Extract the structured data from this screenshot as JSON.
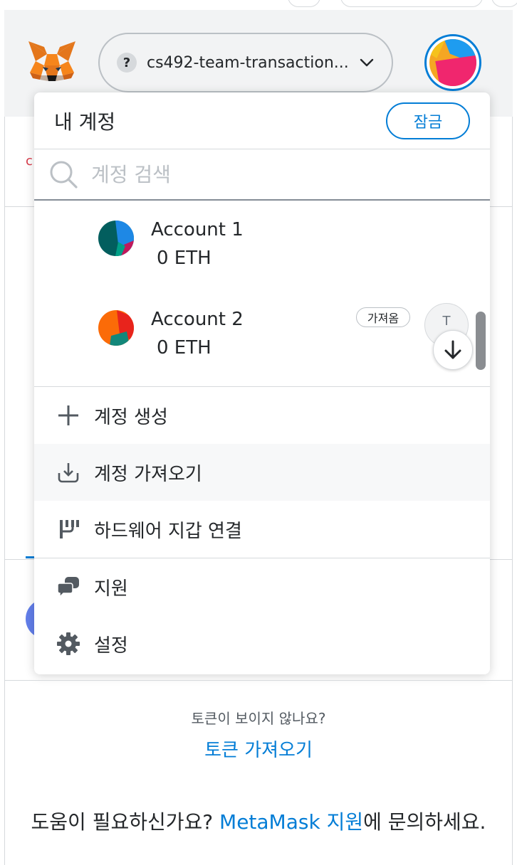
{
  "header": {
    "network_label": "cs492-team-transaction...",
    "network_icon": "question-mark-icon",
    "colors": {
      "accent": "#037dd6",
      "header_bg": "#f2f3f4"
    }
  },
  "account_menu": {
    "title": "내 계정",
    "lock_label": "잠금",
    "search_placeholder": "계정 검색",
    "accounts": [
      {
        "name": "Account 1",
        "balance": "0 ETH"
      },
      {
        "name": "Account 2",
        "balance": "0 ETH",
        "badge": "가져옴",
        "token_initial": "T"
      }
    ],
    "actions": [
      {
        "label": "계정 생성",
        "icon": "plus-icon"
      },
      {
        "label": "계정 가져오기",
        "icon": "import-icon"
      },
      {
        "label": "하드웨어 지갑 연결",
        "icon": "hardware-wallet-icon"
      }
    ],
    "support_items": [
      {
        "label": "지원",
        "icon": "chat-bubbles-icon"
      },
      {
        "label": "설정",
        "icon": "gear-icon"
      }
    ]
  },
  "footer": {
    "no_tokens_text": "토큰이 보이지 않나요?",
    "import_tokens_link": "토큰 가져오기",
    "help_prefix": "도움이 필요하신가요? ",
    "help_link": "MetaMask 지원",
    "help_suffix": "에 문의하세요."
  }
}
